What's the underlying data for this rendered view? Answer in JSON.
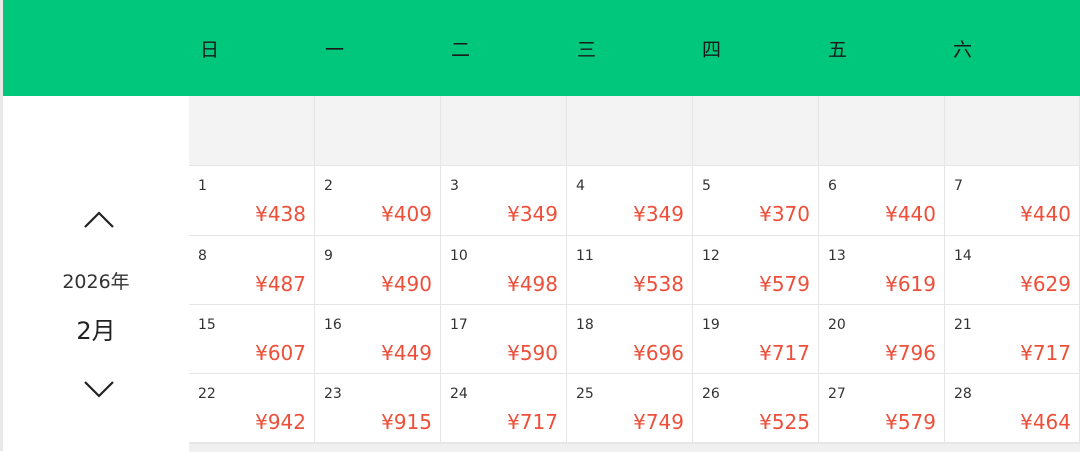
{
  "weekdays": [
    "日",
    "一",
    "二",
    "三",
    "四",
    "五",
    "六"
  ],
  "nav": {
    "year": "2026年",
    "month": "2月",
    "prev_icon": "chevron-up-icon",
    "next_icon": "chevron-down-icon"
  },
  "colors": {
    "header_bg": "#00c77c",
    "price": "#ee4f3a",
    "empty_cell": "#f3f3f3"
  },
  "weeks": [
    [
      {
        "day": "1",
        "price": "¥438"
      },
      {
        "day": "2",
        "price": "¥409"
      },
      {
        "day": "3",
        "price": "¥349"
      },
      {
        "day": "4",
        "price": "¥349"
      },
      {
        "day": "5",
        "price": "¥370"
      },
      {
        "day": "6",
        "price": "¥440"
      },
      {
        "day": "7",
        "price": "¥440"
      }
    ],
    [
      {
        "day": "8",
        "price": "¥487"
      },
      {
        "day": "9",
        "price": "¥490"
      },
      {
        "day": "10",
        "price": "¥498"
      },
      {
        "day": "11",
        "price": "¥538"
      },
      {
        "day": "12",
        "price": "¥579"
      },
      {
        "day": "13",
        "price": "¥619"
      },
      {
        "day": "14",
        "price": "¥629"
      }
    ],
    [
      {
        "day": "15",
        "price": "¥607"
      },
      {
        "day": "16",
        "price": "¥449"
      },
      {
        "day": "17",
        "price": "¥590"
      },
      {
        "day": "18",
        "price": "¥696"
      },
      {
        "day": "19",
        "price": "¥717"
      },
      {
        "day": "20",
        "price": "¥796"
      },
      {
        "day": "21",
        "price": "¥717"
      }
    ],
    [
      {
        "day": "22",
        "price": "¥942"
      },
      {
        "day": "23",
        "price": "¥915"
      },
      {
        "day": "24",
        "price": "¥717"
      },
      {
        "day": "25",
        "price": "¥749"
      },
      {
        "day": "26",
        "price": "¥525"
      },
      {
        "day": "27",
        "price": "¥579"
      },
      {
        "day": "28",
        "price": "¥464"
      }
    ]
  ]
}
